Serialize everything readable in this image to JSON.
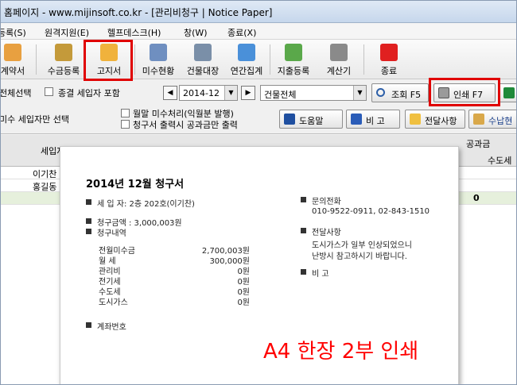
{
  "window": {
    "title": "홈페이지 - www.mijinsoft.co.kr - [관리비청구  |  Notice Paper]"
  },
  "menu": [
    "등록(S)",
    "원격지원(E)",
    "헬프데스크(H)",
    "창(W)",
    "종료(X)"
  ],
  "toolbar": [
    {
      "label": "계약서",
      "icon": "contract-icon",
      "color": "#e8a040"
    },
    {
      "label": "수금등록",
      "icon": "coins-icon",
      "color": "#c49a3a"
    },
    {
      "label": "고지서",
      "icon": "notice-edit-icon",
      "color": "#f0b23c"
    },
    {
      "label": "미수현황",
      "icon": "ledger-icon",
      "color": "#6f8fc0"
    },
    {
      "label": "건물대장",
      "icon": "building-ledger-icon",
      "color": "#7a8fa8"
    },
    {
      "label": "연간집계",
      "icon": "calendar-icon",
      "color": "#4a90d9"
    },
    {
      "label": "지출등록",
      "icon": "expense-icon",
      "color": "#5aa84a"
    },
    {
      "label": "계산기",
      "icon": "calculator-icon",
      "color": "#8a8a8a"
    },
    {
      "label": "종료",
      "icon": "exit-x-icon",
      "color": "#e02020"
    }
  ],
  "filters": {
    "select_all_label": "전체선택",
    "ended_tenants_label": "종결 세입자 포함",
    "period": "2014-12",
    "building": "건물전체",
    "unpaid_only_label": "미수 세입자만 선택",
    "monthly_unpaid_label": "월말 미수처리(익월분 발행)",
    "invoice_amount_label": "청구서 출력시 공과금만 출력"
  },
  "buttons": {
    "query": "조회 F5",
    "print": "인쇄 F7",
    "help": "도움말",
    "memo": "비 고",
    "notice": "전달사항",
    "receipt": "수납현"
  },
  "grid": {
    "headers": {
      "tenant": "세입자명",
      "utilities": "공과금",
      "water": "수도세"
    },
    "rows": [
      {
        "name": "이기찬"
      },
      {
        "name": "홍길동"
      }
    ],
    "total": "0"
  },
  "document": {
    "title": "2014년 12월 청구서",
    "tenant": "세 입 자: 2층 202호(이기찬)",
    "amount": "청구금액 : 3,000,003원",
    "details_label": "청구내역",
    "items": [
      {
        "name": "전월미수금",
        "value": "2,700,003원"
      },
      {
        "name": "월 세",
        "value": "300,000원"
      },
      {
        "name": "관리비",
        "value": "0원"
      },
      {
        "name": "전기세",
        "value": "0원"
      },
      {
        "name": "수도세",
        "value": "0원"
      },
      {
        "name": "도시가스",
        "value": "0원"
      }
    ],
    "account_label": "계좌번호",
    "contact_label": "문의전화",
    "contact_value": "010-9522-0911, 02-843-1510",
    "notice_label": "전달사항",
    "notice_line1": "도시가스가 일부 인상되었으니",
    "notice_line2": "난방시 참고하시기 바랍니다.",
    "memo_label": "비      고"
  },
  "annotation": "A4 한장 2부 인쇄"
}
